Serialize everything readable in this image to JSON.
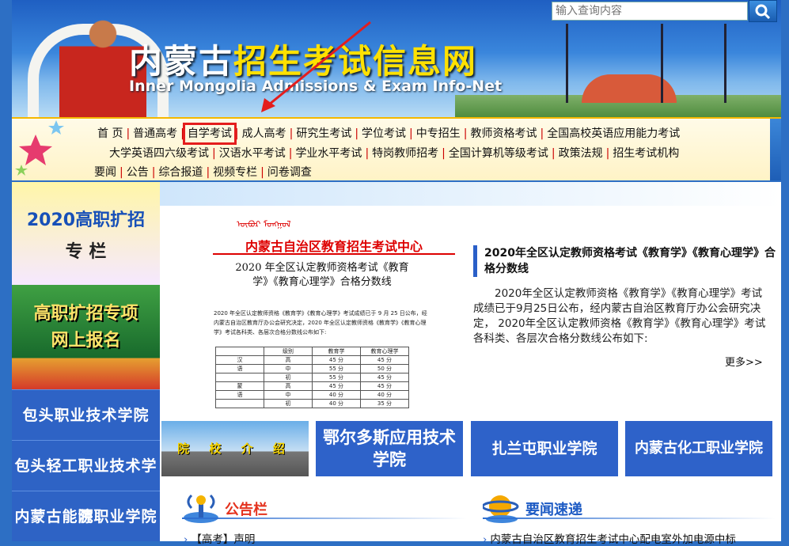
{
  "header": {
    "title_part1": "内蒙古",
    "title_part2": "招生考试信息网",
    "subtitle": "Inner Mongolia Admissions & Exam Info-Net",
    "search_placeholder": "输入查询内容"
  },
  "nav": {
    "rows": [
      [
        "首 页",
        "普通高考",
        "自学考试",
        "成人高考",
        "研究生考试",
        "学位考试",
        "中专招生",
        "教师资格考试",
        "全国高校英语应用能力考试"
      ],
      [
        "大学英语四六级考试",
        "汉语水平考试",
        "学业水平考试",
        "特岗教师招考",
        "全国计算机等级考试",
        "政策法规",
        "招生考试机构"
      ],
      [
        "要闻",
        "公告",
        "综合报道",
        "视频专栏",
        "问卷调查"
      ]
    ],
    "highlighted": "自学考试"
  },
  "sidebar": {
    "promo1_line1": "2020高职扩招",
    "promo1_line2": "专 栏",
    "promo2_line1": "高职扩招专项",
    "promo2_line2": "网上报名",
    "colleges": [
      "包头职业技术学院",
      "包头轻工职业技术学院",
      "内蒙古能源职业学院"
    ]
  },
  "document": {
    "mongolian": "ᠥᠪᠦᠷ ᠮᠣᠩᠭᠣᠯ",
    "org": "内蒙古自治区教育招生考试中心",
    "title_line1": "2020 年全区认定教师资格考试《教育",
    "title_line2": "学》《教育心理学》合格分数线",
    "body": "2020 年全区认定教师资格《教育学》《教育心理学》考试成绩已于 9 月 25 日公布，经内蒙古自治区教育厅办公会研究决定，2020 年全区认定教师资格《教育学》《教育心理学》考试各科类、各层次合格分数线公布如下:",
    "table_header": [
      "级别",
      "教育学",
      "教育心理学"
    ],
    "table_rows": [
      [
        "汉",
        "高",
        "45 分",
        "45 分"
      ],
      [
        "语",
        "中",
        "55 分",
        "50 分"
      ],
      [
        "",
        "初",
        "55 分",
        "45 分"
      ],
      [
        "蒙",
        "高",
        "45 分",
        "45 分"
      ],
      [
        "语",
        "中",
        "40 分",
        "40 分"
      ],
      [
        "",
        "初",
        "40 分",
        "35 分"
      ]
    ]
  },
  "news": {
    "title": "2020年全区认定教师资格考试《教育学》《教育心理学》合格分数线",
    "desc": "2020年全区认定教师资格《教育学》《教育心理学》考试成绩已于9月25日公布，经内蒙古自治区教育厅办公会研究决定， 2020年全区认定教师资格《教育学》《教育心理学》考试各科类、各层次合格分数线公布如下:",
    "more": "更多>>"
  },
  "colleges_row": [
    "院 校 介 绍",
    "鄂尔多斯应用技术学院",
    "扎兰屯职业学院",
    "内蒙古化工职业学院"
  ],
  "sections": {
    "notice_label": "公告栏",
    "news_label": "要闻速递",
    "notice_item": "【高考】声明",
    "news_item": "内蒙古自治区教育招生考试中心配电室外加电源中标"
  }
}
